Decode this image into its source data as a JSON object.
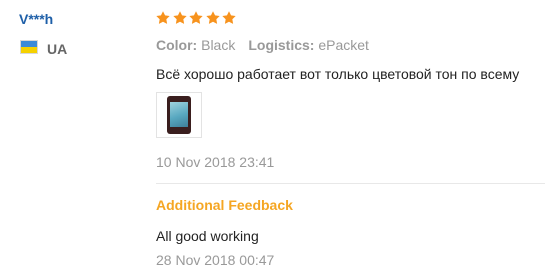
{
  "reviewer": {
    "name": "V***h",
    "country_code": "UA",
    "flag_icon": "ukraine-flag-icon",
    "flag_colors": [
      "#3b8ad9",
      "#f5d100"
    ]
  },
  "review": {
    "rating": 5,
    "rating_max": 5,
    "star_color": "#f7931e",
    "color_label": "Color:",
    "color_value": "Black",
    "logistics_label": "Logistics:",
    "logistics_value": "ePacket",
    "text": "Всё хорошо работает вот только цветовой тон по всему",
    "photo_icon": "phone-photo-thumbnail",
    "date": "10 Nov 2018 23:41"
  },
  "additional_feedback": {
    "title": "Additional Feedback",
    "text": "All good working",
    "date": "28 Nov 2018 00:47"
  },
  "colors": {
    "username": "#1e5fa8",
    "additional_title": "#f5a623",
    "muted": "#999999"
  }
}
